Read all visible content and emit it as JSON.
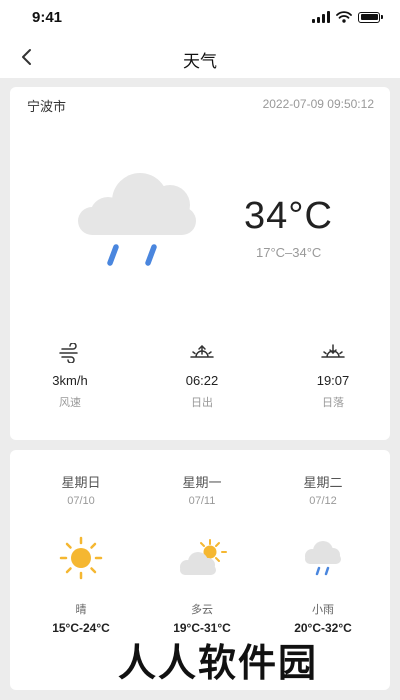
{
  "status_bar": {
    "time": "9:41"
  },
  "nav": {
    "title": "天气"
  },
  "current": {
    "city": "宁波市",
    "datetime": "2022-07-09 09:50:12",
    "condition_icon": "cloud-rain-icon",
    "temperature": "34°C",
    "range": "17°C–34°C"
  },
  "stats": [
    {
      "icon": "wind-icon",
      "value": "3km/h",
      "label": "风速"
    },
    {
      "icon": "sunrise-icon",
      "value": "06:22",
      "label": "日出"
    },
    {
      "icon": "sunset-icon",
      "value": "19:07",
      "label": "日落"
    }
  ],
  "forecast": [
    {
      "day": "星期日",
      "date": "07/10",
      "icon": "sun-icon",
      "condition": "晴",
      "range": "15°C-24°C"
    },
    {
      "day": "星期一",
      "date": "07/11",
      "icon": "partly-cloudy-icon",
      "condition": "多云",
      "range": "19°C-31°C"
    },
    {
      "day": "星期二",
      "date": "07/12",
      "icon": "light-rain-icon",
      "condition": "小雨",
      "range": "20°C-32°C"
    }
  ],
  "watermark": "人人软件园",
  "colors": {
    "rain": "#4a86de",
    "sun": "#f5b731",
    "cloud": "#e6e6e6"
  }
}
